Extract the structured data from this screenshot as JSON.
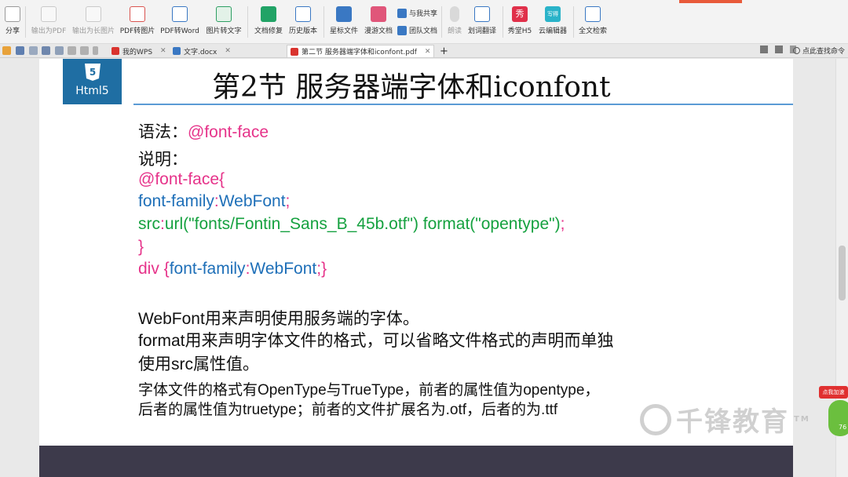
{
  "ribbon": {
    "items": [
      {
        "label": "分享",
        "icon": "share-icon",
        "color": "#8a8a8a"
      },
      {
        "label": "输出为PDF",
        "icon": "pdf-export-icon",
        "color": "#b0b0b0"
      },
      {
        "label": "输出为长图片",
        "icon": "long-image-export-icon",
        "color": "#b0b0b0"
      },
      {
        "label": "PDF转图片",
        "icon": "pdf-to-image-icon",
        "color": "#d9534f"
      },
      {
        "label": "PDF转Word",
        "icon": "pdf-to-word-icon",
        "color": "#3a78c3"
      },
      {
        "label": "图片转文字",
        "icon": "image-to-text-icon",
        "color": "#2e9e63"
      },
      {
        "label": "文档修复",
        "icon": "doc-repair-icon",
        "color": "#21a366"
      },
      {
        "label": "历史版本",
        "icon": "history-icon",
        "color": "#3a78c3"
      },
      {
        "label": "星标文件",
        "icon": "star-file-icon",
        "color": "#3a78c3"
      },
      {
        "label": "漫游文档",
        "icon": "roaming-doc-icon",
        "color": "#e0567a"
      },
      {
        "label": "朗读",
        "icon": "read-aloud-icon",
        "color": "#b0b0b0"
      },
      {
        "label": "划词翻译",
        "icon": "translate-icon",
        "color": "#3a78c3"
      },
      {
        "label": "秀堂H5",
        "icon": "xiutang-icon",
        "color": "#e0304a"
      },
      {
        "label": "云编辑器",
        "icon": "cloud-editor-icon",
        "color": "#2ab3c9"
      },
      {
        "label": "全文检索",
        "icon": "fulltext-search-icon",
        "color": "#3a78c3"
      }
    ],
    "share_with": "与我共享",
    "team_docs": "团队文档",
    "mini_badge_text": "写得",
    "xiu_badge_text": "秀"
  },
  "tabs": [
    {
      "label": "我的WPS",
      "icon": "wps-icon"
    },
    {
      "label": "文字.docx",
      "icon": "docx-icon"
    },
    {
      "label": "第二节 服务器端字体和iconfont.pdf",
      "icon": "pdf-file-icon"
    }
  ],
  "tabbar": {
    "new_tab": "+",
    "search_label": "点此查找命令"
  },
  "slide": {
    "logo_number": "5",
    "logo_text": "Html5",
    "title": "第2节 服务器端字体和iconfont",
    "syntax_label": "语法：",
    "syntax_value": "@font-face",
    "explain_label": "说明：",
    "code": {
      "line1": "@font-face{",
      "line2_prop": "font-family",
      "line2_colon": ":",
      "line2_val": "WebFont",
      "line2_semi": ";",
      "line3_prop": "src",
      "line3_colon": ":",
      "line3_val": "url(\"fonts/Fontin_Sans_B_45b.otf\") format(\"opentype\")",
      "line3_semi": ";",
      "line4": "}",
      "line5_sel": "div {",
      "line5_prop": "font-family",
      "line5_colon": ":",
      "line5_val": "WebFont",
      "line5_end": ";}"
    },
    "desc1": "WebFont用来声明使用服务端的字体。",
    "desc2": "format用来声明字体文件的格式，可以省略文件格式的声明而单独",
    "desc3": "使用src属性值。",
    "desc4": "字体文件的格式有OpenType与TrueType，前者的属性值为opentype，",
    "desc5": "后者的属性值为truetype；前者的文件扩展名为.otf，后者的为.ttf"
  },
  "watermark": {
    "text": "千锋教育",
    "tm": "TM"
  },
  "side_widget": {
    "badge": "点我加速",
    "number": "76"
  },
  "colors": {
    "pink": "#e6338a",
    "blue": "#1e6fb8",
    "green": "#15a13f",
    "logo_bg": "#1f6ea3",
    "footer_bar": "#3d3a4b",
    "title_rule": "#5b9bd5"
  }
}
